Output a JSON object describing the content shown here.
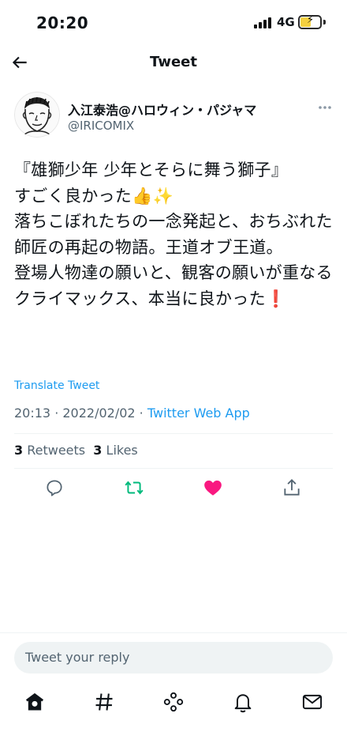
{
  "status_bar": {
    "time": "20:20",
    "network": "4G",
    "battery_level": 0.55
  },
  "header": {
    "title": "Tweet",
    "back_icon": "arrow-left-icon"
  },
  "author": {
    "name": "入江泰浩@ハロウィン・パジャマ",
    "handle": "@IRICOMIX",
    "avatar_icon": "cartoon-face-avatar"
  },
  "tweet": {
    "text": "『雄獅少年 少年とそらに舞う獅子』\nすごく良かった👍✨\n落ちこぼれたちの一念発起と、おちぶれた師匠の再起の物語。王道オブ王道。\n登場人物達の願いと、観客の願いが重なるクライマックス、本当に良かった❗",
    "translate_label": "Translate Tweet",
    "time": "20:13",
    "separator": " · ",
    "date": "2022/02/02",
    "app": "Twitter Web App"
  },
  "stats": {
    "retweets_count": "3",
    "retweets_label": " Retweets",
    "likes_count": "3",
    "likes_label": " Likes"
  },
  "actions": {
    "reply_icon": "comment-icon",
    "retweet_icon": "retweet-icon",
    "like_icon": "heart-icon",
    "share_icon": "share-icon",
    "retweet_color": "#00ba7c",
    "like_color": "#f91880"
  },
  "reply": {
    "placeholder": "Tweet your reply"
  },
  "tabbar": {
    "items": [
      "home-icon",
      "explore-icon",
      "spaces-icon",
      "notifications-icon",
      "messages-icon"
    ]
  }
}
